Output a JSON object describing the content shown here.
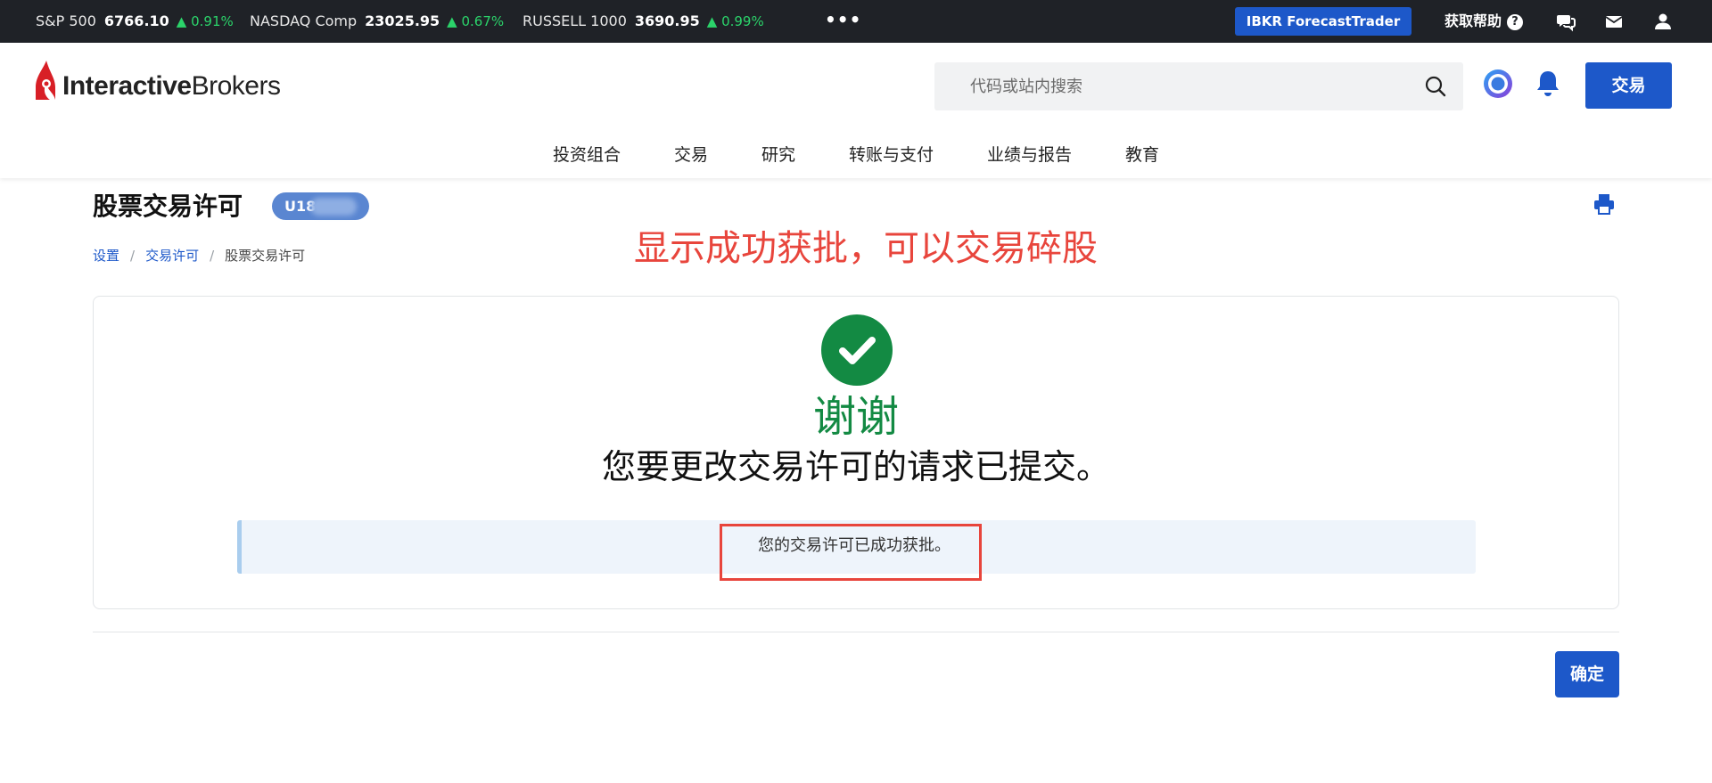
{
  "ticker": {
    "items": [
      {
        "name": "S&P 500",
        "value": "6766.10",
        "change": "▲ 0.91%"
      },
      {
        "name": "NASDAQ Comp",
        "value": "23025.95",
        "change": "▲ 0.67%"
      },
      {
        "name": "RUSSELL 1000",
        "value": "3690.95",
        "change": "▲ 0.99%"
      }
    ],
    "more_label": "•••",
    "forecast_label": "IBKR ForecastTrader",
    "help_label": "获取帮助",
    "help_q": "?",
    "icons": [
      "chat-icon",
      "mail-icon",
      "user-icon"
    ],
    "up_color": "#2bd36a"
  },
  "header": {
    "logo_bold": "Interactive",
    "logo_light": "Brokers",
    "search_placeholder": "代码或站内搜索",
    "trade_label": "交易",
    "nav": [
      "投资组合",
      "交易",
      "研究",
      "转账与支付",
      "业绩与报告",
      "教育"
    ],
    "brand_color": "#1d58c9"
  },
  "page": {
    "title": "股票交易许可",
    "account": "U18",
    "breadcrumb": [
      "设置",
      "交易许可",
      "股票交易许可"
    ],
    "annotation": "显示成功获批，可以交易碎股",
    "annotation_color": "#e8453c"
  },
  "card": {
    "thanks": "谢谢",
    "submitted": "您要更改交易许可的请求已提交。",
    "info": "您的交易许可已成功获批。",
    "success_color": "#138a43"
  },
  "footer": {
    "ok_label": "确定"
  }
}
